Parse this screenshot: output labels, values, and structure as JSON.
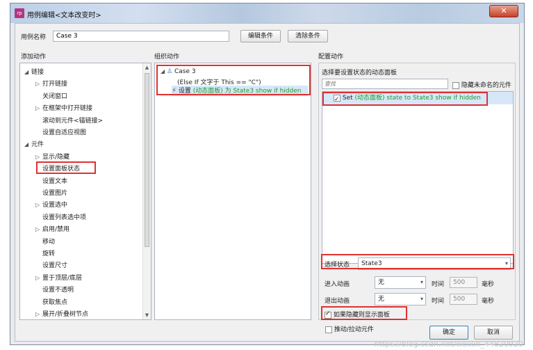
{
  "window": {
    "title": "用例编辑<文本改变时>",
    "app_icon": "rp",
    "close_glyph": "✕"
  },
  "case": {
    "name_label": "用例名称",
    "name_value": "Case 3",
    "edit_condition": "编辑条件",
    "clear_condition": "清除条件"
  },
  "add_actions": {
    "header": "添加动作",
    "tree": [
      {
        "label": "链接",
        "type": "group",
        "expanded": true
      },
      {
        "label": "打开链接",
        "type": "collapsed"
      },
      {
        "label": "关闭窗口",
        "type": "leaf"
      },
      {
        "label": "在框架中打开链接",
        "type": "collapsed"
      },
      {
        "label": "滚动到元件<锚链接>",
        "type": "leaf"
      },
      {
        "label": "设置自适应视图",
        "type": "leaf"
      },
      {
        "label": "元件",
        "type": "group",
        "expanded": true
      },
      {
        "label": "显示/隐藏",
        "type": "collapsed"
      },
      {
        "label": "设置面板状态",
        "type": "leaf"
      },
      {
        "label": "设置文本",
        "type": "leaf"
      },
      {
        "label": "设置图片",
        "type": "leaf"
      },
      {
        "label": "设置选中",
        "type": "collapsed"
      },
      {
        "label": "设置列表选中项",
        "type": "leaf"
      },
      {
        "label": "启用/禁用",
        "type": "collapsed"
      },
      {
        "label": "移动",
        "type": "leaf"
      },
      {
        "label": "旋转",
        "type": "leaf"
      },
      {
        "label": "设置尺寸",
        "type": "leaf"
      },
      {
        "label": "置于顶层/底层",
        "type": "collapsed"
      },
      {
        "label": "设置不透明",
        "type": "leaf"
      },
      {
        "label": "获取焦点",
        "type": "leaf"
      },
      {
        "label": "展开/折叠树节点",
        "type": "collapsed"
      }
    ]
  },
  "organize_actions": {
    "header": "组织动作",
    "case_name": "Case 3",
    "case_condition": "(Else If 文字于 This == \"C\")",
    "action_prefix": "设置 ",
    "action_detail": "(动态面板) 为 State3 show if hidden"
  },
  "configure_actions": {
    "header": "配置动作",
    "select_panel_label": "选择要设置状态的动态面板",
    "search_placeholder": "查找",
    "hide_unnamed_label": "隐藏未命名的元件",
    "panel_item_prefix": "Set ",
    "panel_item_detail": "(动态面板) state to State3 show if hidden",
    "select_state_label": "选择状态",
    "select_state_value": "State3",
    "enter_anim_label": "进入动画",
    "enter_anim_value": "无",
    "exit_anim_label": "退出动画",
    "exit_anim_value": "无",
    "time_label": "时间",
    "time_value": "500",
    "ms_label": "毫秒",
    "show_if_hidden_label": "如果隐藏则显示面板",
    "push_pull_label": "推动/拉动元件"
  },
  "footer": {
    "ok": "确定",
    "cancel": "取消",
    "watermark": "https://blog.csdn.net/weixin_44820920"
  },
  "colors": {
    "highlight_red": "#e03131",
    "action_green": "#1e9a2e",
    "selected_row": "#d6e8f8"
  }
}
